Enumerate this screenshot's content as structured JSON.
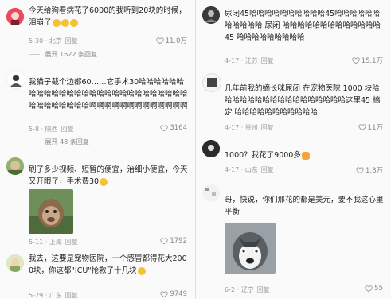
{
  "left": {
    "c1": {
      "text": "今天给狗看病花了6000的我听到20块的时候，泪崩了",
      "meta": "5-30 · 北京",
      "reply": "回复",
      "likes": "11.0万",
      "expand": "展开 1622 条回复"
    },
    "c2": {
      "text": "我猫子截个边都60……它手术30哈哈哈哈哈哈哈哈哈哈哈哈哈哈哈哈哈哈哈哈哈哈哈哈哈哈哈哈哈哈哈哈哈哈哈啊啊啊啊啊啊啊啊啊啊啊啊啊",
      "meta": "5-8 · 陕西",
      "reply": "回复",
      "likes": "3164",
      "expand": "展开 48 条回复"
    },
    "c3": {
      "text": "刷了多少视频、短暂的便宜，治细小便宜，今天又开眼了，手术费30",
      "meta": "5-11 · 上海",
      "reply": "回复",
      "likes": "1792"
    },
    "c4": {
      "text": "我去，这要是宠物医院，一个感冒都得花大2000块，你这都\"ICU\"抢救了十几块",
      "meta": "5-29 · 广东",
      "reply": "回复",
      "likes": "9749"
    }
  },
  "right": {
    "c1": {
      "text": "尿闭45哈哈哈哈哈哈哈哈哈哈45哈哈哈哈哈哈哈哈哈哈哈 尿闭 哈哈哈哈哈哈哈哈哈哈哈哈哈45 哈哈哈哈哈哈哈哈哈",
      "meta": "4-17 · 江苏",
      "reply": "回复",
      "likes": "15.1万"
    },
    "c2": {
      "text": "几年前我的嫡长咪尿闭 在宠物医院 1000 块哈哈哈哈哈哈哈哈哈哈哈哈哈哈哈哈哈这里45 搞定 哈哈哈哈哈哈哈哈哈哈哈",
      "meta": "4-17 · 贵州",
      "reply": "回复",
      "likes": "11万"
    },
    "c3": {
      "text": "1000？我花了9000多",
      "meta": "4-17 · 山东",
      "reply": "回复",
      "likes": "1.8万"
    },
    "c4": {
      "text": "哥，快说，你们那花的都是美元，要不我这心里平衡",
      "meta": "6-2 · 辽宁",
      "reply": "回复",
      "likes": "55"
    }
  },
  "colors": {
    "heart": "#999999",
    "meta": "#999999",
    "text": "#222222"
  }
}
